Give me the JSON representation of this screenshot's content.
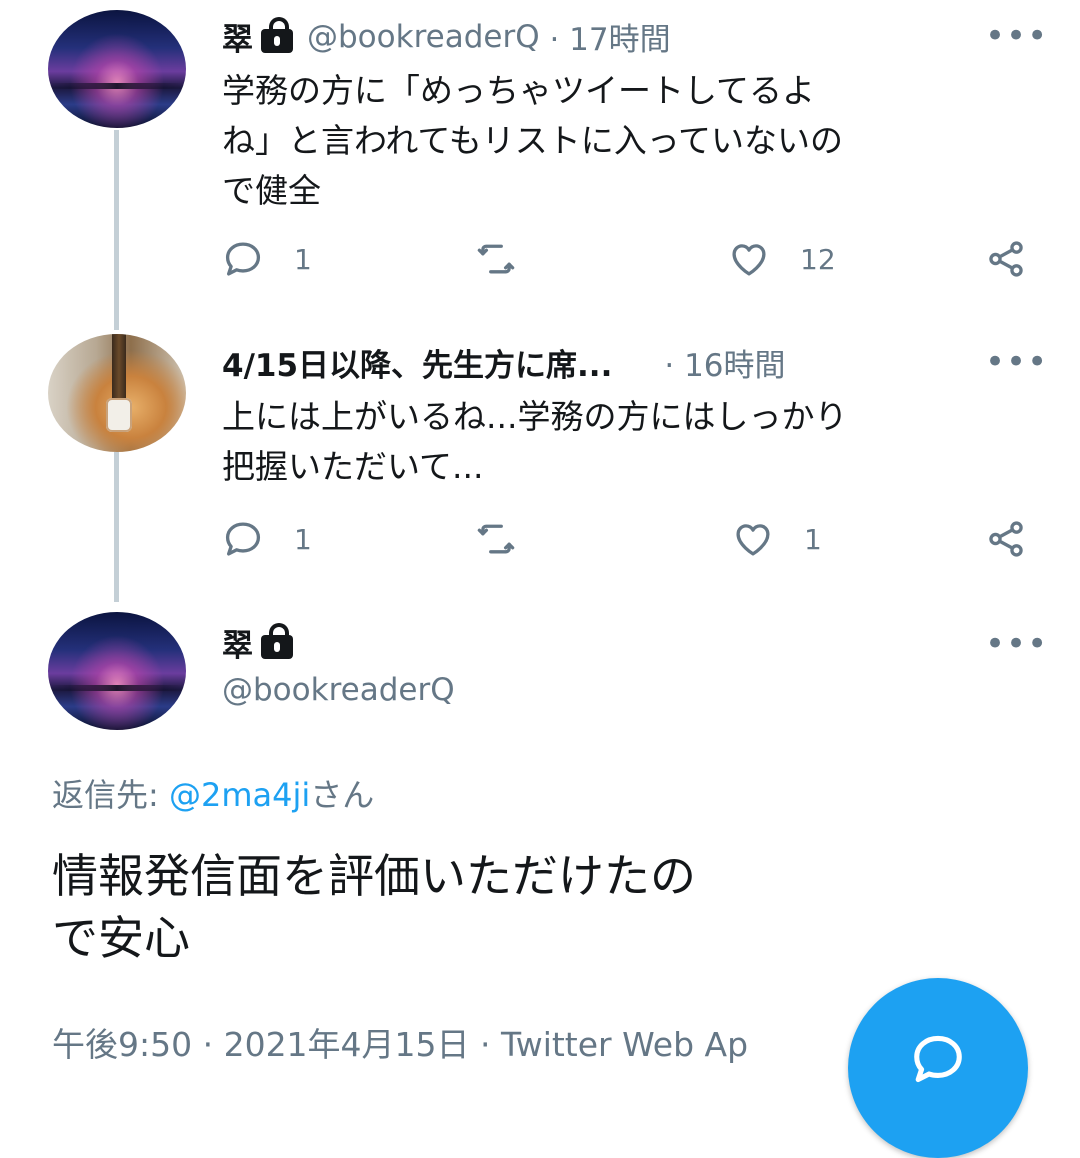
{
  "tweets": [
    {
      "name": "翠",
      "handle": "@bookreaderQ",
      "time": "· 17時間",
      "text_lines": [
        "学務の方に「めっちゃツイートしてるよ",
        "ね」と言われてもリストに入っていないの",
        "で健全"
      ],
      "reply_count": "1",
      "retweet_count": "",
      "like_count": "12"
    },
    {
      "name": "4/15日以降、先生方に席...",
      "handle": "",
      "time": "· 16時間",
      "text_lines": [
        "上には上がいるね...学務の方にはしっかり",
        "把握いただいて..."
      ],
      "reply_count": "1",
      "retweet_count": "",
      "like_count": "1"
    }
  ],
  "main_tweet": {
    "name": "翠",
    "handle": "@bookreaderQ",
    "reply_prefix": "返信先: ",
    "reply_mention": "@2ma4ji",
    "reply_suffix": "さん",
    "text_lines": [
      "情報発信面を評価いただけたの",
      "で安心"
    ],
    "meta": "午後9:50 · 2021年4月15日 · Twitter Web Ap"
  },
  "icons": {
    "lock": "lock-icon",
    "more": "more-icon",
    "reply": "reply-icon",
    "retweet": "retweet-icon",
    "like": "heart-icon",
    "share": "share-icon",
    "compose": "compose-reply-icon"
  },
  "glyphs": {
    "more": "•••"
  },
  "colors": {
    "accent": "#1da1f2",
    "text": "#14171a",
    "muted": "#657786",
    "thread_line": "#c4cfd6"
  }
}
